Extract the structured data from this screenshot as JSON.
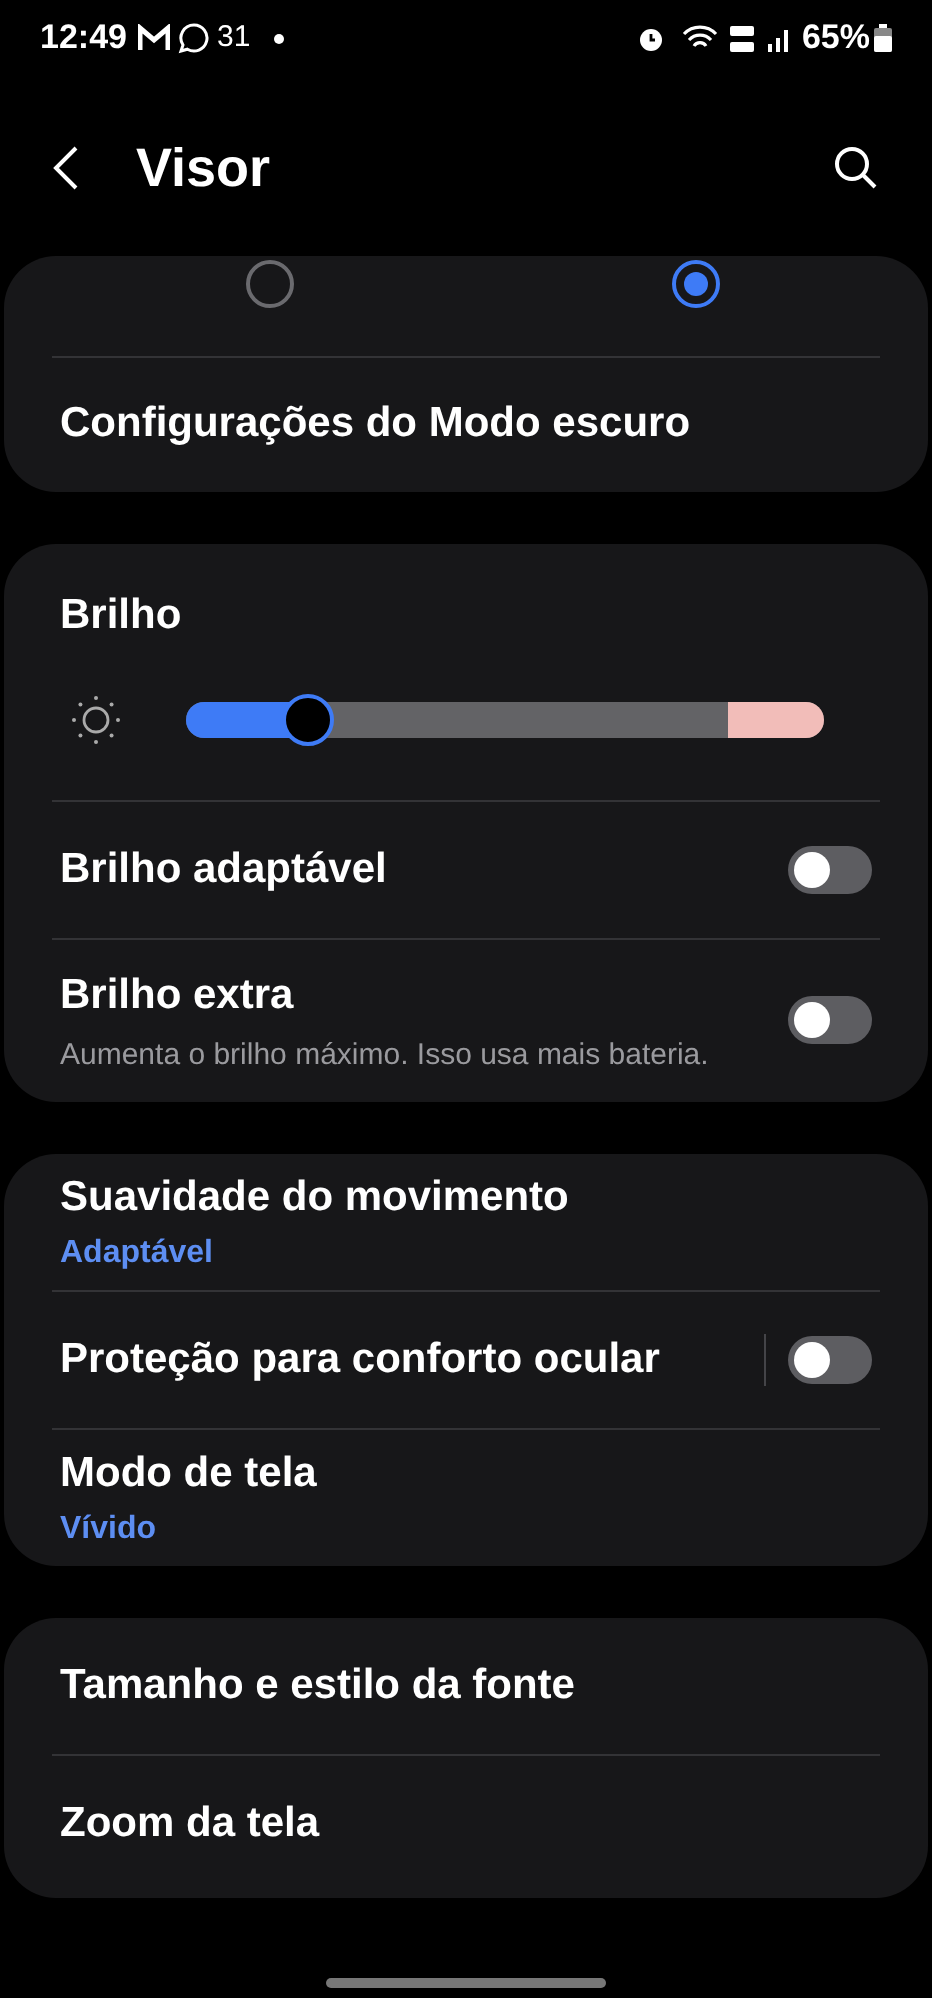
{
  "status_bar": {
    "time": "12:49",
    "temperature": "31",
    "battery": "65%"
  },
  "header": {
    "title": "Visor"
  },
  "dark_mode": {
    "radios": [
      {
        "selected": false
      },
      {
        "selected": true
      }
    ],
    "settings_label": "Configurações do Modo escuro"
  },
  "brightness": {
    "title": "Brilho",
    "level": 0.19,
    "rows": [
      {
        "title": "Brilho adaptável",
        "on": false
      },
      {
        "title": "Brilho extra",
        "subtitle": "Aumenta o brilho máximo. Isso usa mais bateria.",
        "on": false
      }
    ]
  },
  "motion_group": [
    {
      "kind": "value",
      "title": "Suavidade do movimento",
      "value": "Adaptável"
    },
    {
      "kind": "toggle",
      "title": "Proteção para conforto ocular",
      "on": false
    },
    {
      "kind": "value",
      "title": "Modo de tela",
      "value": "Vívido"
    }
  ],
  "font_group": [
    {
      "title": "Tamanho e estilo da fonte"
    },
    {
      "title": "Zoom da tela"
    }
  ]
}
